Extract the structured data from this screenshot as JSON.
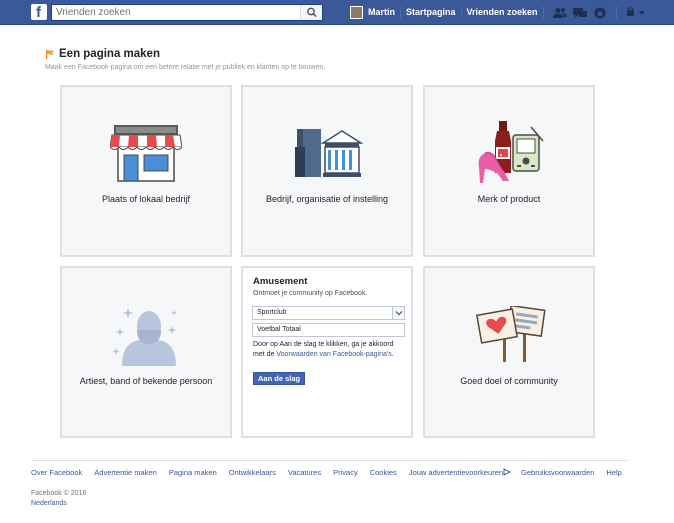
{
  "header": {
    "logo": "f",
    "search_placeholder": "Vrienden zoeken",
    "user_name": "Martin",
    "home_label": "Startpagina",
    "find_friends_label": "Vrienden zoeken",
    "icons": [
      "friend-requests-icon",
      "messages-icon",
      "notifications-icon",
      "privacy-shortcuts-icon",
      "account-menu-icon"
    ]
  },
  "page": {
    "title": "Een pagina maken",
    "subtitle": "Maak een Facebook-pagina om een betere relatie met je publiek en klanten op te bouwen."
  },
  "categories": [
    {
      "label": "Plaats of lokaal bedrijf",
      "icon": "storefront-icon"
    },
    {
      "label": "Bedrijf, organisatie of instelling",
      "icon": "company-building-icon"
    },
    {
      "label": "Merk of product",
      "icon": "brand-products-icon"
    },
    {
      "label": "Artiest, band of bekende persoon",
      "icon": "artist-silhouette-icon"
    },
    {
      "label": "Goed doel of community",
      "icon": "community-signs-icon"
    }
  ],
  "entertainment": {
    "title": "Amusement",
    "subtitle": "Ontmoet je community op Facebook.",
    "selected_category": "Sportclub",
    "page_name_value": "Voetbal Totaal",
    "terms_prefix": "Door op Aan de slag te klikken, ga je akkoord met de ",
    "terms_link": "Voorwaarden van Facebook-pagina's",
    "terms_suffix": ".",
    "button_label": "Aan de slag"
  },
  "footer": {
    "links": [
      "Over Facebook",
      "Advertentie maken",
      "Pagina maken",
      "Ontwikkelaars",
      "Vacatures",
      "Privacy",
      "Cookies",
      "Jouw advertentievoorkeuren",
      "Gebruiksvoorwaarden",
      "Help"
    ],
    "copyright": "Facebook © 2016",
    "language": "Nederlands"
  },
  "colors": {
    "brand": "#3b5998",
    "card_bg": "#f6f7f9",
    "card_border": "#dddfe2",
    "link": "#365899",
    "button": "#4267b2"
  }
}
